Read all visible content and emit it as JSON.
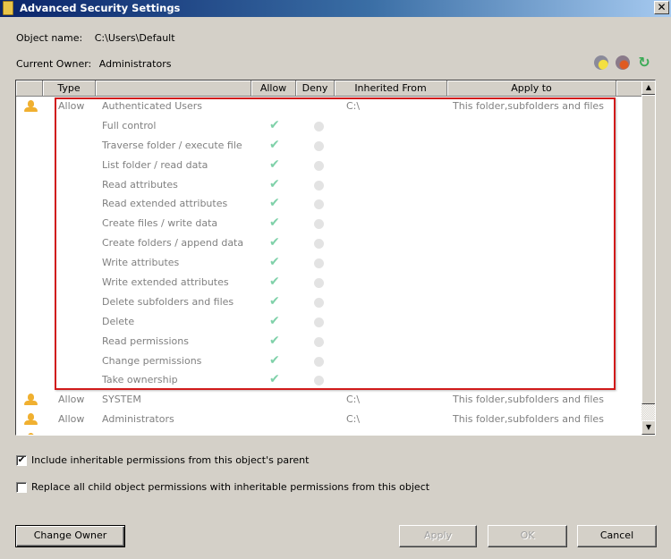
{
  "window": {
    "title": "Advanced Security Settings",
    "close_label": "✕"
  },
  "object_name": {
    "label": "Object name:",
    "value": "C:\\Users\\Default"
  },
  "current_owner": {
    "label": "Current Owner:",
    "value": "Administrators"
  },
  "toolbar": {
    "icons": [
      "add-permission-icon",
      "remove-permission-icon",
      "restore-defaults-icon"
    ]
  },
  "list": {
    "columns": [
      "",
      "Type",
      "",
      "Allow",
      "Deny",
      "Inherited From",
      "Apply to"
    ],
    "rows": [
      {
        "kind": "principal",
        "type": "Allow",
        "name": "Authenticated Users",
        "inherited_from": "C:\\",
        "apply_to": "This folder,subfolders and files"
      },
      {
        "kind": "permission",
        "name": "Full control",
        "allow": "✔",
        "deny": ""
      },
      {
        "kind": "permission",
        "name": "Traverse folder / execute file",
        "allow": "✔",
        "deny": ""
      },
      {
        "kind": "permission",
        "name": "List folder / read data",
        "allow": "✔",
        "deny": ""
      },
      {
        "kind": "permission",
        "name": "Read attributes",
        "allow": "✔",
        "deny": ""
      },
      {
        "kind": "permission",
        "name": "Read extended attributes",
        "allow": "✔",
        "deny": ""
      },
      {
        "kind": "permission",
        "name": "Create files / write data",
        "allow": "✔",
        "deny": ""
      },
      {
        "kind": "permission",
        "name": "Create folders / append data",
        "allow": "✔",
        "deny": ""
      },
      {
        "kind": "permission",
        "name": "Write attributes",
        "allow": "✔",
        "deny": ""
      },
      {
        "kind": "permission",
        "name": "Write extended attributes",
        "allow": "✔",
        "deny": ""
      },
      {
        "kind": "permission",
        "name": "Delete subfolders and files",
        "allow": "✔",
        "deny": ""
      },
      {
        "kind": "permission",
        "name": "Delete",
        "allow": "✔",
        "deny": ""
      },
      {
        "kind": "permission",
        "name": "Read permissions",
        "allow": "✔",
        "deny": ""
      },
      {
        "kind": "permission",
        "name": "Change permissions",
        "allow": "✔",
        "deny": ""
      },
      {
        "kind": "permission",
        "name": "Take ownership",
        "allow": "✔",
        "deny": ""
      },
      {
        "kind": "principal",
        "type": "Allow",
        "name": "SYSTEM",
        "inherited_from": "C:\\",
        "apply_to": "This folder,subfolders and files"
      },
      {
        "kind": "principal",
        "type": "Allow",
        "name": "Administrators",
        "inherited_from": "C:\\",
        "apply_to": "This folder,subfolders and files"
      }
    ],
    "scroll_up": "▲",
    "scroll_down": "▼"
  },
  "options": {
    "include_inheritable": {
      "label": "Include inheritable permissions from this object's parent",
      "checked": true,
      "mark": "✔"
    },
    "replace_child": {
      "label": "Replace all child object permissions with inheritable permissions from this object",
      "checked": false,
      "mark": ""
    }
  },
  "buttons": {
    "change_owner": "Change Owner",
    "apply": "Apply",
    "ok": "OK",
    "cancel": "Cancel"
  },
  "colors": {
    "highlight_border": "#d11a1a",
    "allow_check": "#7fd1a9",
    "user_icon": "#f0b030"
  }
}
